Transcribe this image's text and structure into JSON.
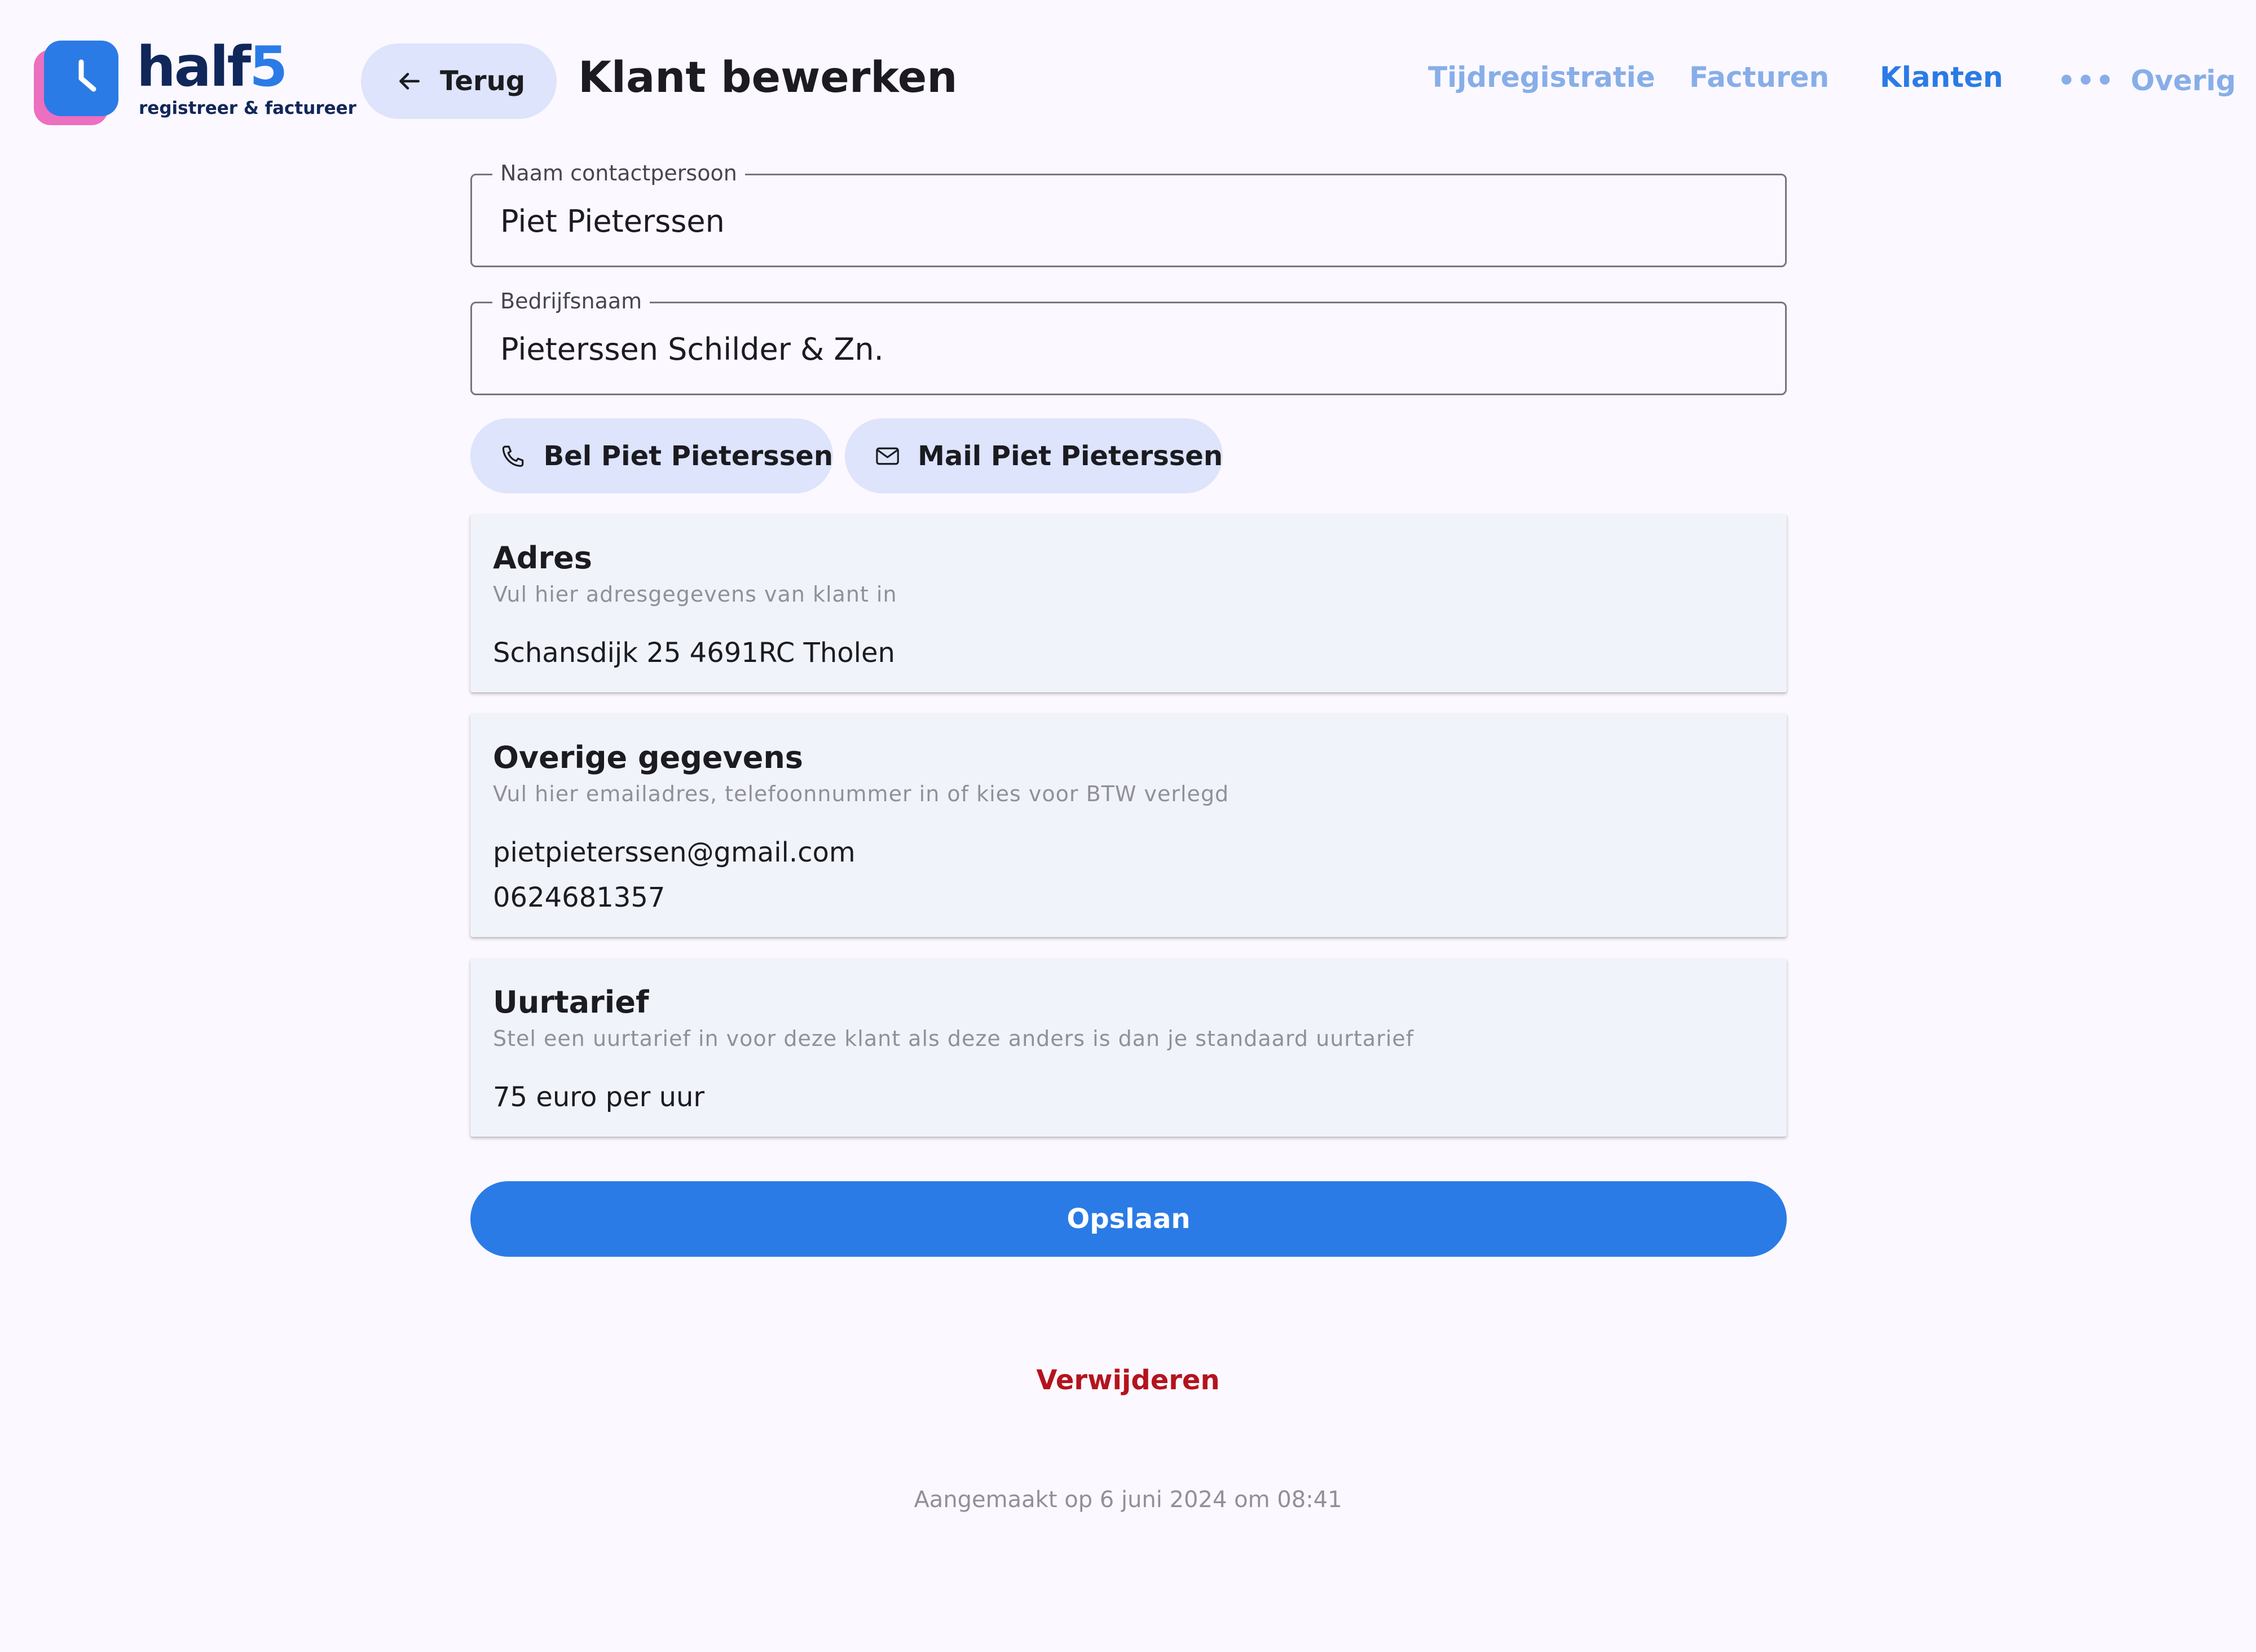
{
  "app": {
    "logo_word": "half",
    "logo_digit": "5",
    "logo_tagline": "registreer & factureer"
  },
  "header": {
    "back_label": "Terug",
    "page_title": "Klant bewerken"
  },
  "nav": {
    "items": [
      {
        "label": "Tijdregistratie",
        "active": false
      },
      {
        "label": "Facturen",
        "active": false
      },
      {
        "label": "Klanten",
        "active": true
      },
      {
        "label": "Overig",
        "active": false
      }
    ]
  },
  "form": {
    "contact_name": {
      "label": "Naam contactpersoon",
      "value": "Piet Pieterssen"
    },
    "company_name": {
      "label": "Bedrijfsnaam",
      "value": "Pieterssen Schilder & Zn."
    }
  },
  "actions": {
    "call_label": "Bel Piet Pieterssen",
    "mail_label": "Mail Piet Pieterssen",
    "call_icon": "phone-icon",
    "mail_icon": "mail-icon"
  },
  "cards": {
    "address": {
      "title": "Adres",
      "subtitle": "Vul hier adresgegevens van klant in",
      "value": "Schansdijk 25 4691RC Tholen"
    },
    "other": {
      "title": "Overige gegevens",
      "subtitle": "Vul hier emailadres, telefoonnummer in of kies voor BTW verlegd",
      "email": "pietpieterssen@gmail.com",
      "phone": "0624681357"
    },
    "rate": {
      "title": "Uurtarief",
      "subtitle": "Stel een uurtarief in voor deze klant als deze anders is dan je standaard uurtarief",
      "value": "75 euro per uur"
    }
  },
  "footer": {
    "save_label": "Opslaan",
    "delete_label": "Verwijderen",
    "created_at": "Aangemaakt op 6 juni 2024 om 08:41"
  },
  "colors": {
    "primary": "#2b7be6",
    "tonal": "#dde4fb",
    "danger": "#b3141d",
    "nav_inactive": "#87aee8",
    "logo_navy": "#10275a",
    "logo_pink": "#ec6fc0"
  }
}
